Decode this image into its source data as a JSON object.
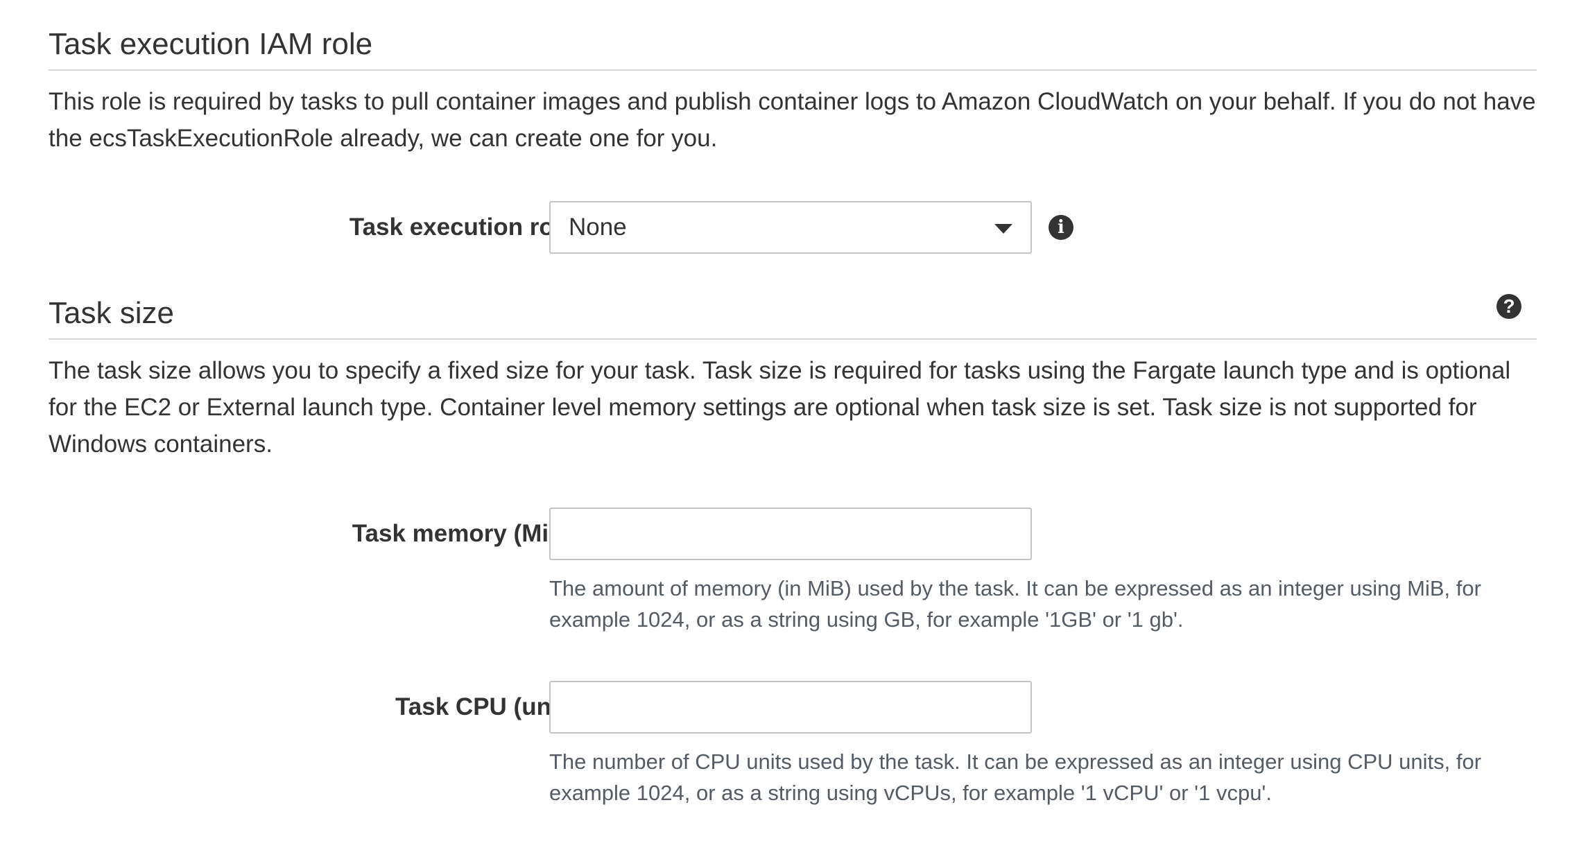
{
  "iam_section": {
    "title": "Task execution IAM role",
    "description": "This role is required by tasks to pull container images and publish container logs to Amazon CloudWatch on your behalf. If you do not have the ecsTaskExecutionRole already, we can create one for you.",
    "role_field": {
      "label": "Task execution role",
      "selected_value": "None",
      "info_icon": "info-icon"
    }
  },
  "task_size_section": {
    "title": "Task size",
    "help_icon": "question-circle-icon",
    "description": "The task size allows you to specify a fixed size for your task. Task size is required for tasks using the Fargate launch type and is optional for the EC2 or External launch type. Container level memory settings are optional when task size is set. Task size is not supported for Windows containers.",
    "memory_field": {
      "label": "Task memory (MiB)",
      "value": "",
      "placeholder": "",
      "hint": "The amount of memory (in MiB) used by the task. It can be expressed as an integer using MiB, for example 1024, or as a string using GB, for example '1GB' or '1 gb'."
    },
    "cpu_field": {
      "label": "Task CPU (unit)",
      "value": "",
      "placeholder": "",
      "hint": "The number of CPU units used by the task. It can be expressed as an integer using CPU units, for example 1024, or as a string using vCPUs, for example '1 vCPU' or '1 vcpu'."
    }
  }
}
